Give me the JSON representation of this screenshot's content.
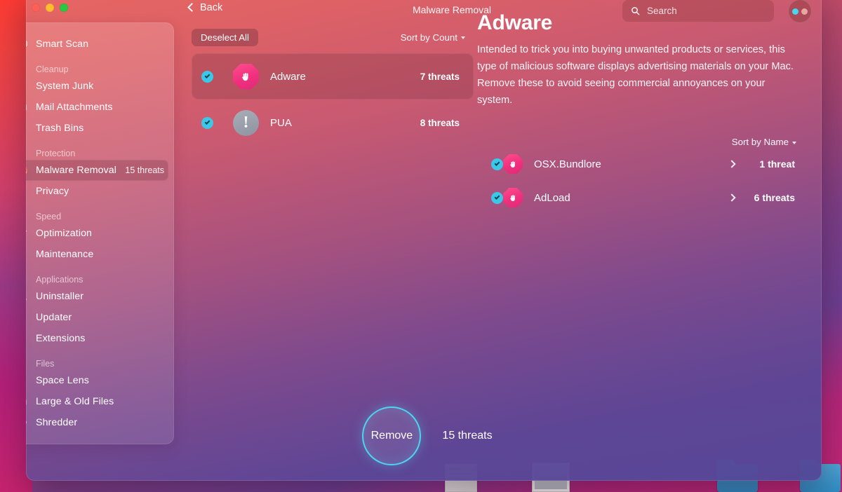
{
  "window": {
    "title": "Malware Removal",
    "back_label": "Back",
    "traffic_lights": [
      "close",
      "minimize",
      "zoom"
    ]
  },
  "search": {
    "placeholder": "Search",
    "value": "",
    "icon": "search-icon"
  },
  "account": {
    "icon": "avatar-icon",
    "dot_colors": [
      "#46d8f0",
      "#e8a7a0"
    ]
  },
  "sidebar": {
    "groups": [
      {
        "label": "",
        "items": [
          {
            "label": "Smart Scan",
            "icon": "scanner-icon",
            "badge": "",
            "active": false
          }
        ]
      },
      {
        "label": "Cleanup",
        "items": [
          {
            "label": "System Junk",
            "icon": "broom-icon",
            "badge": "",
            "active": false
          },
          {
            "label": "Mail Attachments",
            "icon": "mail-icon",
            "badge": "",
            "active": false
          },
          {
            "label": "Trash Bins",
            "icon": "trash-icon",
            "badge": "",
            "active": false
          }
        ]
      },
      {
        "label": "Protection",
        "items": [
          {
            "label": "Malware Removal",
            "icon": "biohazard-icon",
            "badge": "15 threats",
            "active": true
          },
          {
            "label": "Privacy",
            "icon": "hand-icon",
            "badge": "",
            "active": false
          }
        ]
      },
      {
        "label": "Speed",
        "items": [
          {
            "label": "Optimization",
            "icon": "sliders-icon",
            "badge": "",
            "active": false
          },
          {
            "label": "Maintenance",
            "icon": "wrench-icon",
            "badge": "",
            "active": false
          }
        ]
      },
      {
        "label": "Applications",
        "items": [
          {
            "label": "Uninstaller",
            "icon": "uninstaller-icon",
            "badge": "",
            "active": false
          },
          {
            "label": "Updater",
            "icon": "refresh-icon",
            "badge": "",
            "active": false
          },
          {
            "label": "Extensions",
            "icon": "puzzle-icon",
            "badge": "",
            "active": false
          }
        ]
      },
      {
        "label": "Files",
        "items": [
          {
            "label": "Space Lens",
            "icon": "lens-icon",
            "badge": "",
            "active": false
          },
          {
            "label": "Large & Old Files",
            "icon": "folder-icon",
            "badge": "",
            "active": false
          },
          {
            "label": "Shredder",
            "icon": "shredder-icon",
            "badge": "",
            "active": false
          }
        ]
      }
    ]
  },
  "list_panel": {
    "deselect_label": "Deselect All",
    "sort_label": "Sort by Count",
    "rows": [
      {
        "name": "Adware",
        "count": "7 threats",
        "icon": "stop-hand-icon",
        "checked": true,
        "selected": true
      },
      {
        "name": "PUA",
        "count": "8 threats",
        "icon": "exclamation-icon",
        "checked": true,
        "selected": false
      }
    ]
  },
  "detail_panel": {
    "title": "Adware",
    "description": "Intended to trick you into buying unwanted products or services, this type of malicious software displays advertising materials on your Mac. Remove these to avoid seeing commercial annoyances on your system.",
    "sort_label": "Sort by Name",
    "items": [
      {
        "name": "OSX.Bundlore",
        "count": "1 threat",
        "icon": "stop-hand-icon",
        "checked": true
      },
      {
        "name": "AdLoad",
        "count": "6 threats",
        "icon": "stop-hand-icon",
        "checked": true
      }
    ]
  },
  "action_bar": {
    "button_label": "Remove",
    "total_label": "15 threats",
    "accent_color": "#4fd4ef"
  }
}
